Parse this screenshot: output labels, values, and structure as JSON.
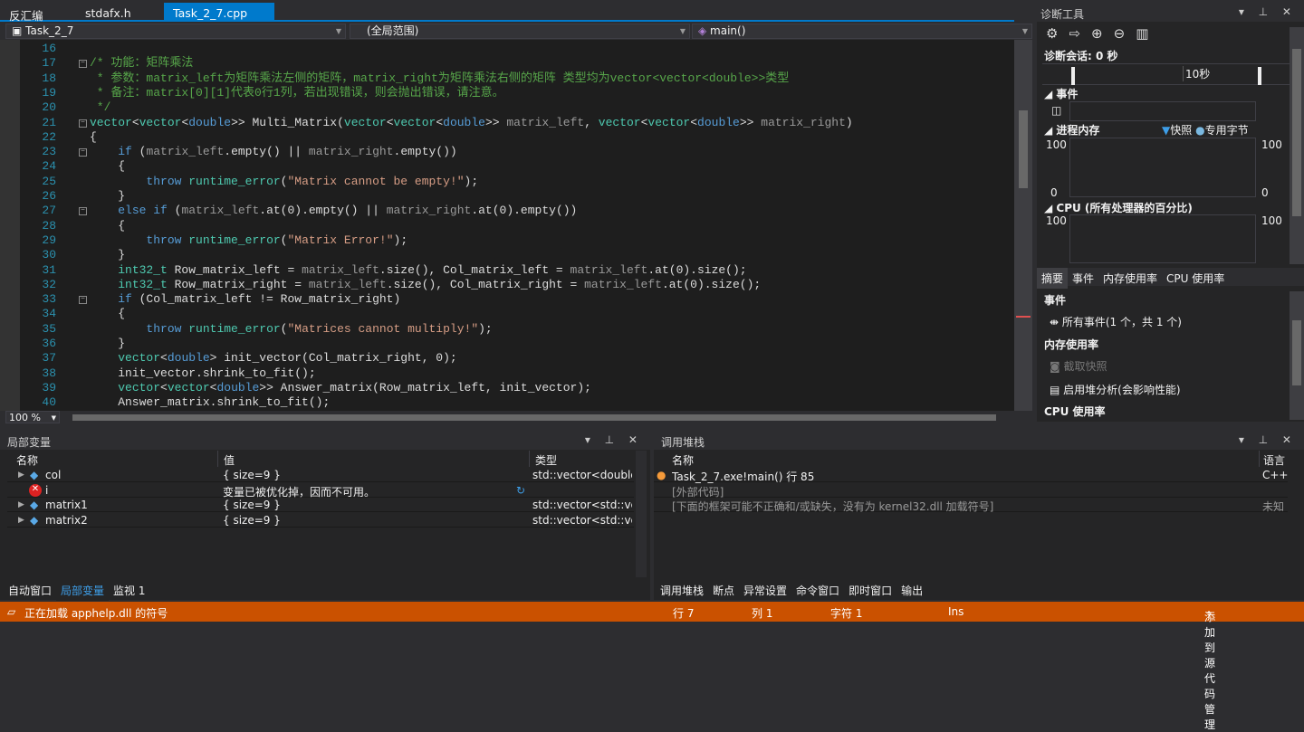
{
  "tabs": [
    {
      "label": "反汇编"
    },
    {
      "label": "stdafx.h"
    },
    {
      "label": "Task_2_7.cpp",
      "active": true,
      "pin": "⊣",
      "close": "✕"
    }
  ],
  "nav": {
    "project": "Task_2_7",
    "scope": "(全局范围)",
    "member": "main()"
  },
  "editor": {
    "zoom": "100 %",
    "code": [
      {
        "n": "16",
        "t": []
      },
      {
        "n": "17",
        "fold": true,
        "t": [
          [
            "c",
            "/* 功能：矩阵乘法"
          ]
        ]
      },
      {
        "n": "18",
        "t": [
          [
            "c",
            " * 参数：matrix_left为矩阵乘法左侧的矩阵，matrix_right为矩阵乘法右侧的矩阵 类型均为vector<vector<double>>类型"
          ]
        ]
      },
      {
        "n": "19",
        "t": [
          [
            "c",
            " * 备注：matrix[0][1]代表0行1列，若出现错误，则会抛出错误，请注意。"
          ]
        ]
      },
      {
        "n": "20",
        "t": [
          [
            "c",
            " */"
          ]
        ]
      },
      {
        "n": "21",
        "fold": true,
        "t": [
          [
            "t",
            "vector"
          ],
          [
            "p",
            "<"
          ],
          [
            "t",
            "vector"
          ],
          [
            "p",
            "<"
          ],
          [
            "k",
            "double"
          ],
          [
            "p",
            ">> Multi_Matrix("
          ],
          [
            "t",
            "vector"
          ],
          [
            "p",
            "<"
          ],
          [
            "t",
            "vector"
          ],
          [
            "p",
            "<"
          ],
          [
            "k",
            "double"
          ],
          [
            "p",
            ">> "
          ],
          [
            "g",
            "matrix_left"
          ],
          [
            "p",
            ", "
          ],
          [
            "t",
            "vector"
          ],
          [
            "p",
            "<"
          ],
          [
            "t",
            "vector"
          ],
          [
            "p",
            "<"
          ],
          [
            "k",
            "double"
          ],
          [
            "p",
            ">> "
          ],
          [
            "g",
            "matrix_right"
          ],
          [
            "p",
            ")"
          ]
        ]
      },
      {
        "n": "22",
        "t": [
          [
            "p",
            "{"
          ]
        ]
      },
      {
        "n": "23",
        "fold": true,
        "t": [
          [
            "p",
            "    "
          ],
          [
            "k",
            "if"
          ],
          [
            "p",
            " ("
          ],
          [
            "g",
            "matrix_left"
          ],
          [
            "p",
            ".empty() || "
          ],
          [
            "g",
            "matrix_right"
          ],
          [
            "p",
            ".empty())"
          ]
        ]
      },
      {
        "n": "24",
        "t": [
          [
            "p",
            "    {"
          ]
        ]
      },
      {
        "n": "25",
        "t": [
          [
            "p",
            "        "
          ],
          [
            "k",
            "throw"
          ],
          [
            "p",
            " "
          ],
          [
            "t",
            "runtime_error"
          ],
          [
            "p",
            "("
          ],
          [
            "s",
            "\"Matrix cannot be empty!\""
          ],
          [
            "p",
            ");"
          ]
        ]
      },
      {
        "n": "26",
        "t": [
          [
            "p",
            "    }"
          ]
        ]
      },
      {
        "n": "27",
        "fold": true,
        "t": [
          [
            "p",
            "    "
          ],
          [
            "k",
            "else if"
          ],
          [
            "p",
            " ("
          ],
          [
            "g",
            "matrix_left"
          ],
          [
            "p",
            ".at(0).empty() || "
          ],
          [
            "g",
            "matrix_right"
          ],
          [
            "p",
            ".at(0).empty())"
          ]
        ]
      },
      {
        "n": "28",
        "t": [
          [
            "p",
            "    {"
          ]
        ]
      },
      {
        "n": "29",
        "t": [
          [
            "p",
            "        "
          ],
          [
            "k",
            "throw"
          ],
          [
            "p",
            " "
          ],
          [
            "t",
            "runtime_error"
          ],
          [
            "p",
            "("
          ],
          [
            "s",
            "\"Matrix Error!\""
          ],
          [
            "p",
            ");"
          ]
        ]
      },
      {
        "n": "30",
        "t": [
          [
            "p",
            "    }"
          ]
        ]
      },
      {
        "n": "31",
        "t": [
          [
            "p",
            "    "
          ],
          [
            "t",
            "int32_t"
          ],
          [
            "p",
            " Row_matrix_left = "
          ],
          [
            "g",
            "matrix_left"
          ],
          [
            "p",
            ".size(), Col_matrix_left = "
          ],
          [
            "g",
            "matrix_left"
          ],
          [
            "p",
            ".at(0).size();"
          ]
        ]
      },
      {
        "n": "32",
        "t": [
          [
            "p",
            "    "
          ],
          [
            "t",
            "int32_t"
          ],
          [
            "p",
            " Row_matrix_right = "
          ],
          [
            "g",
            "matrix_left"
          ],
          [
            "p",
            ".size(), Col_matrix_right = "
          ],
          [
            "g",
            "matrix_left"
          ],
          [
            "p",
            ".at(0).size();"
          ]
        ]
      },
      {
        "n": "33",
        "fold": true,
        "t": [
          [
            "p",
            "    "
          ],
          [
            "k",
            "if"
          ],
          [
            "p",
            " (Col_matrix_left != Row_matrix_right)"
          ]
        ]
      },
      {
        "n": "34",
        "t": [
          [
            "p",
            "    {"
          ]
        ]
      },
      {
        "n": "35",
        "t": [
          [
            "p",
            "        "
          ],
          [
            "k",
            "throw"
          ],
          [
            "p",
            " "
          ],
          [
            "t",
            "runtime_error"
          ],
          [
            "p",
            "("
          ],
          [
            "s",
            "\"Matrices cannot multiply!\""
          ],
          [
            "p",
            ");"
          ]
        ]
      },
      {
        "n": "36",
        "t": [
          [
            "p",
            "    }"
          ]
        ]
      },
      {
        "n": "37",
        "t": [
          [
            "p",
            "    "
          ],
          [
            "t",
            "vector"
          ],
          [
            "p",
            "<"
          ],
          [
            "k",
            "double"
          ],
          [
            "p",
            "> init_vector(Col_matrix_right, 0);"
          ]
        ]
      },
      {
        "n": "38",
        "t": [
          [
            "p",
            "    init_vector.shrink_to_fit();"
          ]
        ]
      },
      {
        "n": "39",
        "t": [
          [
            "p",
            "    "
          ],
          [
            "t",
            "vector"
          ],
          [
            "p",
            "<"
          ],
          [
            "t",
            "vector"
          ],
          [
            "p",
            "<"
          ],
          [
            "k",
            "double"
          ],
          [
            "p",
            ">> Answer_matrix(Row_matrix_left, init_vector);"
          ]
        ]
      },
      {
        "n": "40",
        "t": [
          [
            "p",
            "    Answer_matrix.shrink_to_fit();"
          ]
        ]
      }
    ]
  },
  "locals": {
    "title": "局部变量",
    "headers": [
      "名称",
      "值",
      "类型"
    ],
    "rows": [
      {
        "name": "col",
        "value": "{ size=9 }",
        "type": "std::vector<double,s..."
      },
      {
        "name": "i",
        "value": "变量已被优化掉，因而不可用。",
        "type": "",
        "error": true
      },
      {
        "name": "matrix1",
        "value": "{ size=9 }",
        "type": "std::vector<std::vect..."
      },
      {
        "name": "matrix2",
        "value": "{ size=9 }",
        "type": "std::vector<std::vect..."
      }
    ],
    "tabs": [
      "自动窗口",
      "局部变量",
      "监视 1"
    ],
    "active_tab": 1
  },
  "callstack": {
    "title": "调用堆栈",
    "headers": [
      "名称",
      "语言"
    ],
    "rows": [
      {
        "name": "Task_2_7.exe!main() 行 85",
        "lang": "C++",
        "current": true
      },
      {
        "name": "[外部代码]",
        "lang": ""
      },
      {
        "name": "[下面的框架可能不正确和/或缺失，没有为 kernel32.dll 加载符号]",
        "lang": "未知"
      }
    ],
    "tabs": [
      "调用堆栈",
      "断点",
      "异常设置",
      "命令窗口",
      "即时窗口",
      "输出"
    ],
    "active_tab": 0
  },
  "diag": {
    "title": "诊断工具",
    "session": "诊断会话: 0 秒",
    "tick": "10秒",
    "events": "事件",
    "memory": "进程内存",
    "snapshot": "快照",
    "private_bytes": "专用字节",
    "mem_max": "100",
    "mem_min": "0",
    "cpu": "CPU (所有处理器的百分比)",
    "cpu_max": "100",
    "tabs": [
      "摘要",
      "事件",
      "内存使用率",
      "CPU 使用率"
    ],
    "sec_events": "事件",
    "all_events": "所有事件(1 个，共 1 个)",
    "sec_mem": "内存使用率",
    "take_snapshot": "截取快照",
    "heap": "启用堆分析(会影响性能)",
    "sec_cpu": "CPU 使用率"
  },
  "status": {
    "message": "正在加载 apphelp.dll 的符号",
    "line": "行 7",
    "col": "列 1",
    "char": "字符 1",
    "mode": "Ins",
    "scm": "添加到源代码管理"
  },
  "colors": {
    "accent": "#007acc",
    "status": "#ca5100"
  }
}
